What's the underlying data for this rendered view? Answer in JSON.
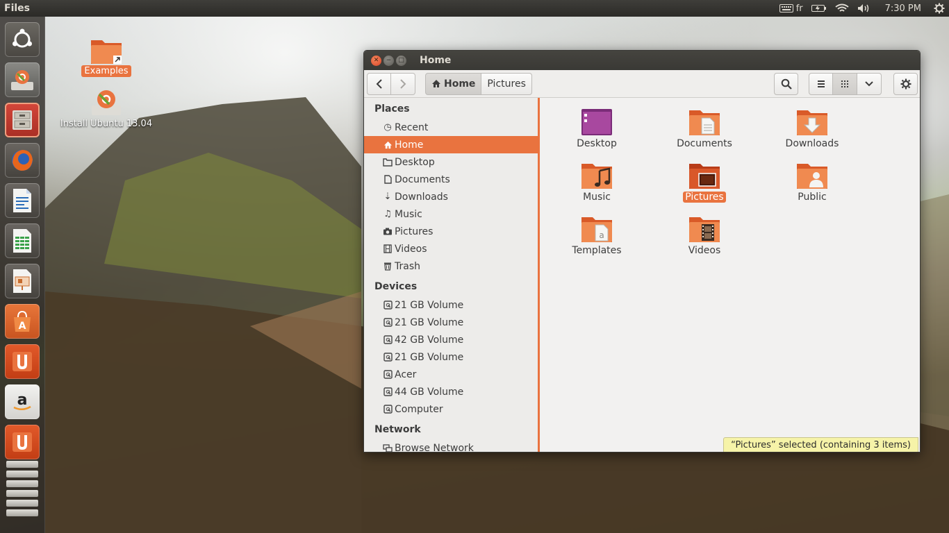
{
  "top_panel": {
    "app_title": "Files",
    "keyboard_layout": "fr",
    "clock": "7:30 PM"
  },
  "launcher": {
    "items": [
      {
        "name": "Dash home",
        "icon": "ubuntu-logo-icon"
      },
      {
        "name": "Install Ubuntu",
        "icon": "ubuntu-installer-icon"
      },
      {
        "name": "Files",
        "icon": "file-manager-icon"
      },
      {
        "name": "Firefox",
        "icon": "firefox-icon"
      },
      {
        "name": "LibreOffice Writer",
        "icon": "writer-icon"
      },
      {
        "name": "LibreOffice Calc",
        "icon": "calc-icon"
      },
      {
        "name": "LibreOffice Impress",
        "icon": "impress-icon"
      },
      {
        "name": "Ubuntu Software Center",
        "icon": "software-center-icon"
      },
      {
        "name": "Ubuntu One",
        "icon": "ubuntu-one-icon"
      },
      {
        "name": "Amazon",
        "icon": "amazon-icon"
      },
      {
        "name": "Ubuntu One Music",
        "icon": "ubuntu-one-music-icon"
      }
    ]
  },
  "desktop": {
    "icons": [
      {
        "label": "Examples",
        "selected": true
      },
      {
        "label": "Install Ubuntu 13.04",
        "selected": false
      }
    ]
  },
  "window": {
    "title": "Home",
    "path": [
      "Home",
      "Pictures"
    ],
    "sidebar": {
      "places_header": "Places",
      "places": [
        "Recent",
        "Home",
        "Desktop",
        "Documents",
        "Downloads",
        "Music",
        "Pictures",
        "Videos",
        "Trash"
      ],
      "active_place": "Home",
      "devices_header": "Devices",
      "devices": [
        "21 GB Volume",
        "21 GB Volume",
        "42 GB Volume",
        "21 GB Volume",
        "Acer",
        "44 GB Volume",
        "Computer"
      ],
      "network_header": "Network",
      "network": [
        "Browse Network"
      ]
    },
    "files": [
      {
        "label": "Desktop",
        "kind": "desktop-folder"
      },
      {
        "label": "Documents",
        "kind": "documents-folder"
      },
      {
        "label": "Downloads",
        "kind": "downloads-folder"
      },
      {
        "label": "Music",
        "kind": "music-folder"
      },
      {
        "label": "Pictures",
        "kind": "pictures-folder",
        "selected": true
      },
      {
        "label": "Public",
        "kind": "public-folder"
      },
      {
        "label": "Templates",
        "kind": "templates-folder"
      },
      {
        "label": "Videos",
        "kind": "videos-folder"
      }
    ],
    "status": "“Pictures” selected  (containing 3 items)"
  },
  "colors": {
    "accent": "#e9733f",
    "panel": "#3c3b37",
    "status_bg": "#f6f3a8"
  }
}
